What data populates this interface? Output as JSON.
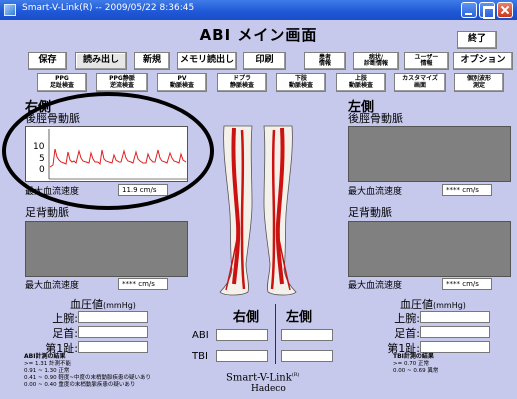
{
  "window": {
    "title": "Smart-V-Link(R) --    2009/05/22  8:36:45"
  },
  "main_title": "ABI メイン画面",
  "top_buttons": {
    "save": "保存",
    "load": "読み出し",
    "new": "新規",
    "memory_load": "メモリ読出し",
    "print": "印刷",
    "patient_info": "患者\n情報",
    "history": "病状/\n診断情報",
    "user_info": "ユーザー\n情報",
    "exit": "終了",
    "options": "オプション"
  },
  "exam_buttons": [
    {
      "label": "PPG\n足趾検査"
    },
    {
      "label": "PPG静脈\n逆流検査"
    },
    {
      "label": "PV\n動脈検査"
    },
    {
      "label": "ドプラ\n静脈検査"
    },
    {
      "label": "下肢\n動脈検査"
    },
    {
      "label": "上肢\n動脈検査"
    },
    {
      "label": "カスタマイズ\n画面"
    },
    {
      "label": "個別波形\n測定"
    }
  ],
  "right_side": {
    "heading": "右側",
    "pt_label": "後脛骨動脈",
    "pt_velocity_label": "最大血流速度",
    "pt_velocity_value": "11.9 cm/s",
    "dp_label": "足背動脈",
    "dp_velocity_label": "最大血流速度",
    "dp_velocity_value": "**** cm/s"
  },
  "left_side": {
    "heading": "左側",
    "pt_label": "後脛骨動脈",
    "pt_velocity_label": "最大血流速度",
    "pt_velocity_value": "**** cm/s",
    "dp_label": "足背動脈",
    "dp_velocity_label": "最大血流速度",
    "dp_velocity_value": "**** cm/s"
  },
  "waveform": {
    "y_ticks": [
      "10",
      "5",
      "0"
    ],
    "color": "#e02020"
  },
  "blood_pressure": {
    "title": "血圧値",
    "unit": "(mmHg)",
    "rows": [
      "上腕:",
      "足首:",
      "第1趾:"
    ]
  },
  "index_table": {
    "right_header": "右側",
    "left_header": "左側",
    "abi_label": "ABI",
    "tbi_label": "TBI"
  },
  "abi_legend": {
    "title": "ABI計測の結果",
    "lines": [
      ">= 1.31    計測不能",
      "0.91 ~ 1.30   正常",
      "0.41 ~ 0.90   軽度~中度の末梢動脈疾患の疑いあり",
      "0.00 ~ 0.40   重度の末梢動脈疾患の疑いあり"
    ]
  },
  "tbi_legend": {
    "title": "TBI計測の結果",
    "lines": [
      ">= 0.70    正常",
      "0.00 ~ 0.69   異常"
    ]
  },
  "brand": {
    "name": "Smart-V-Link",
    "sup": "(R)",
    "company": "Hadeco"
  },
  "colors": {
    "background": "#c6c8ec",
    "leg_vessel": "#cc1111",
    "annotation": "#000000"
  }
}
